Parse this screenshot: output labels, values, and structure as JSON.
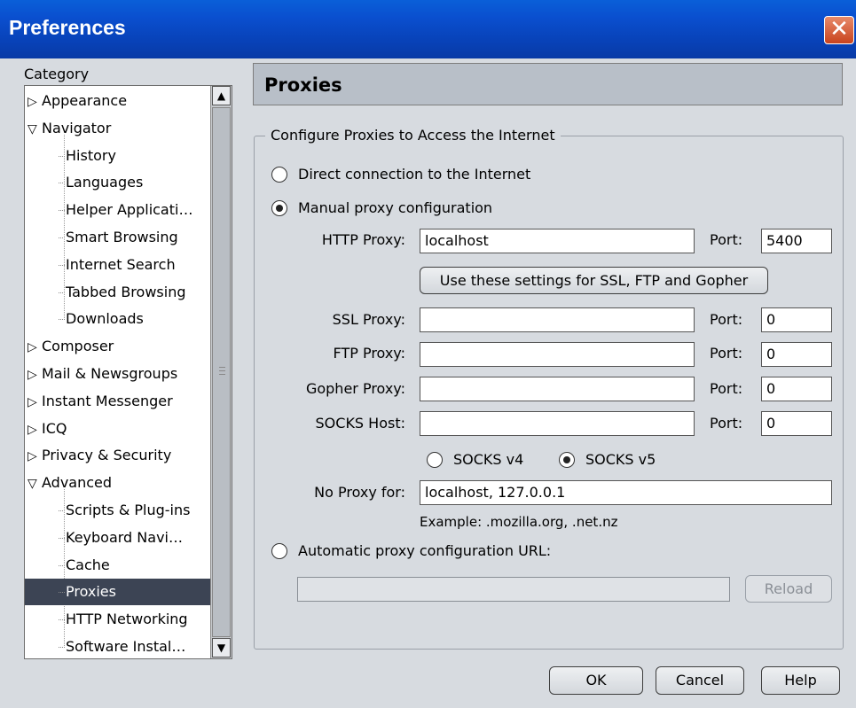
{
  "window": {
    "title": "Preferences",
    "close_glyph": "✕"
  },
  "category": {
    "label": "Category",
    "items": [
      {
        "label": "Appearance",
        "level": 0,
        "state": "collapsed"
      },
      {
        "label": "Navigator",
        "level": 0,
        "state": "expanded"
      },
      {
        "label": "History",
        "level": 1
      },
      {
        "label": "Languages",
        "level": 1
      },
      {
        "label": "Helper Applicati…",
        "level": 1
      },
      {
        "label": "Smart Browsing",
        "level": 1
      },
      {
        "label": "Internet Search",
        "level": 1
      },
      {
        "label": "Tabbed Browsing",
        "level": 1
      },
      {
        "label": "Downloads",
        "level": 1
      },
      {
        "label": "Composer",
        "level": 0,
        "state": "collapsed"
      },
      {
        "label": "Mail & Newsgroups",
        "level": 0,
        "state": "collapsed"
      },
      {
        "label": "Instant Messenger",
        "level": 0,
        "state": "collapsed"
      },
      {
        "label": "ICQ",
        "level": 0,
        "state": "collapsed"
      },
      {
        "label": "Privacy & Security",
        "level": 0,
        "state": "collapsed"
      },
      {
        "label": "Advanced",
        "level": 0,
        "state": "expanded"
      },
      {
        "label": "Scripts & Plug-ins",
        "level": 1
      },
      {
        "label": "Keyboard Navi…",
        "level": 1
      },
      {
        "label": "Cache",
        "level": 1
      },
      {
        "label": "Proxies",
        "level": 1,
        "selected": true
      },
      {
        "label": "HTTP Networking",
        "level": 1
      },
      {
        "label": "Software Instal…",
        "level": 1
      }
    ]
  },
  "panel": {
    "title": "Proxies",
    "group_label": "Configure Proxies to Access the Internet",
    "direct_label": "Direct connection to the Internet",
    "manual_label": "Manual proxy configuration",
    "selected_mode": "manual",
    "http_label": "HTTP Proxy:",
    "http_value": "localhost",
    "http_port_label": "Port:",
    "http_port": "5400",
    "use_settings_label": "Use these settings for SSL, FTP and Gopher",
    "ssl_label": "SSL Proxy:",
    "ssl_value": "",
    "ssl_port_label": "Port:",
    "ssl_port": "0",
    "ftp_label": "FTP Proxy:",
    "ftp_value": "",
    "ftp_port_label": "Port:",
    "ftp_port": "0",
    "gopher_label": "Gopher Proxy:",
    "gopher_value": "",
    "gopher_port_label": "Port:",
    "gopher_port": "0",
    "socks_label": "SOCKS Host:",
    "socks_value": "",
    "socks_port_label": "Port:",
    "socks_port": "0",
    "socks_v4_label": "SOCKS v4",
    "socks_v5_label": "SOCKS v5",
    "socks_version": "v5",
    "noproxy_label": "No Proxy for:",
    "noproxy_value": "localhost, 127.0.0.1",
    "example_text": "Example: .mozilla.org, .net.nz",
    "auto_label": "Automatic proxy configuration URL:",
    "auto_value": "",
    "reload_label": "Reload"
  },
  "footer": {
    "ok_label": "OK",
    "cancel_label": "Cancel",
    "help_label": "Help"
  },
  "colors": {
    "titlebar": "#0a4fcf",
    "selected_row": "#3c4454",
    "background": "#d7dbe0"
  }
}
